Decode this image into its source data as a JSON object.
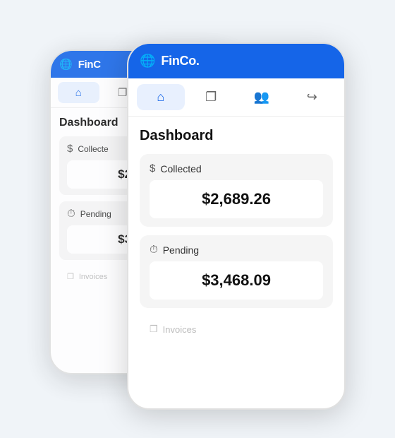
{
  "app": {
    "name": "FinCo.",
    "globe_icon": "🌐"
  },
  "nav": {
    "items": [
      {
        "id": "home",
        "label": "Home",
        "icon": "⌂",
        "active": true
      },
      {
        "id": "documents",
        "label": "Documents",
        "icon": "❐",
        "active": false
      },
      {
        "id": "team",
        "label": "Team",
        "icon": "👥",
        "active": false
      },
      {
        "id": "logout",
        "label": "Logout",
        "icon": "↪",
        "active": false
      }
    ]
  },
  "dashboard": {
    "title": "Dashboard",
    "cards": [
      {
        "id": "collected",
        "label": "Collected",
        "icon": "$",
        "value": "$2,689.26"
      },
      {
        "id": "pending",
        "label": "Pending",
        "icon": "⏱",
        "value": "$3,468.09"
      }
    ],
    "invoices_label": "Invoices"
  }
}
